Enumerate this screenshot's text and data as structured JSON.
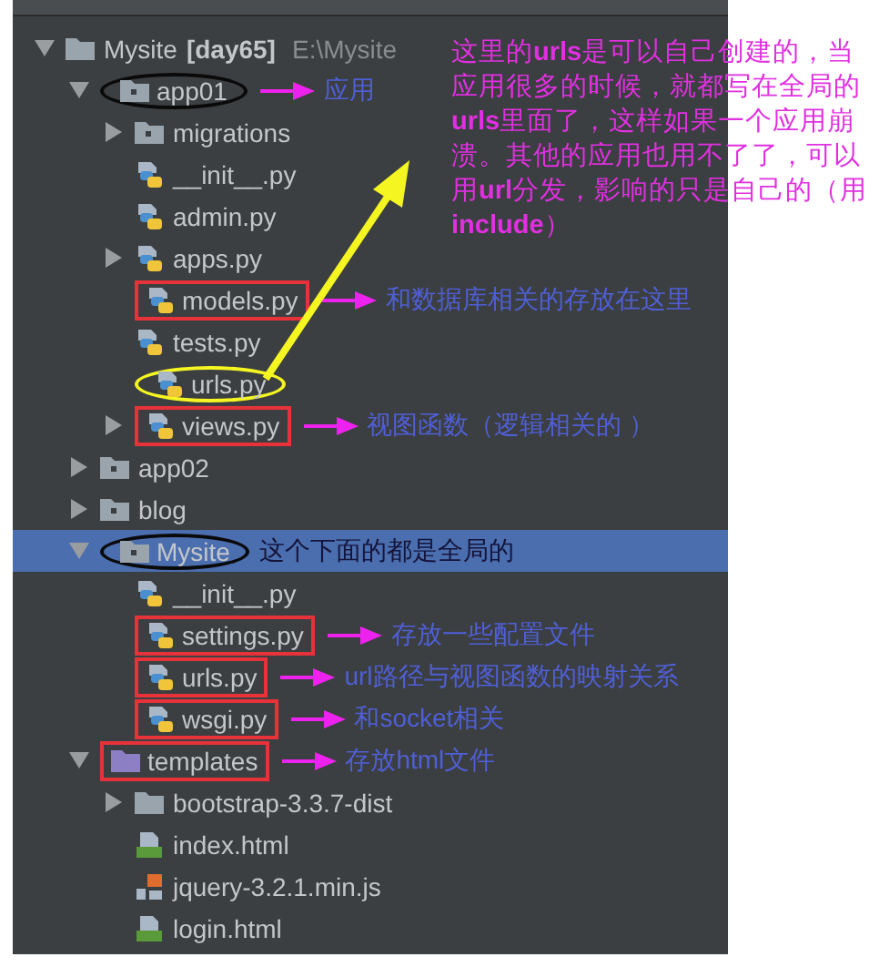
{
  "panel": {
    "tree": [
      {
        "label": "Mysite",
        "suffix": "[day65]",
        "path": "E:\\Mysite",
        "kind": "project",
        "expanded": true,
        "selected": false,
        "children": [
          {
            "label": "app01",
            "kind": "package",
            "expanded": true,
            "selected": false,
            "highlight": {
              "kind": "ellipse",
              "color": "#0a0a0a"
            },
            "note": {
              "text": "应用",
              "arrow": true,
              "color": "#4f5fd6"
            },
            "children": [
              {
                "label": "migrations",
                "kind": "package",
                "expanded": false,
                "selected": false
              },
              {
                "label": "__init__.py",
                "kind": "python",
                "selected": false
              },
              {
                "label": "admin.py",
                "kind": "python",
                "selected": false
              },
              {
                "label": "apps.py",
                "kind": "python",
                "expanded": false,
                "selected": false
              },
              {
                "label": "models.py",
                "kind": "python",
                "selected": false,
                "highlight": {
                  "kind": "box",
                  "color": "#e8323a"
                },
                "note": {
                  "text": "和数据库相关的存放在这里",
                  "arrow": true,
                  "color": "#4f5fd6"
                }
              },
              {
                "label": "tests.py",
                "kind": "python",
                "selected": false
              },
              {
                "label": "urls.py",
                "kind": "python",
                "selected": false,
                "highlight": {
                  "kind": "ellipse",
                  "color": "#f5f522"
                }
              },
              {
                "label": "views.py",
                "kind": "python",
                "expanded": false,
                "selected": false,
                "highlight": {
                  "kind": "box",
                  "color": "#e8323a"
                },
                "note": {
                  "text": "视图函数（逻辑相关的 ）",
                  "arrow": true,
                  "color": "#4f5fd6"
                }
              }
            ]
          },
          {
            "label": "app02",
            "kind": "package",
            "expanded": false,
            "selected": false
          },
          {
            "label": "blog",
            "kind": "package",
            "expanded": false,
            "selected": false
          },
          {
            "label": "Mysite",
            "kind": "package",
            "expanded": true,
            "selected": true,
            "highlight": {
              "kind": "ellipse",
              "color": "#0a0a0a"
            },
            "note": {
              "text": "这个下面的都是全局的",
              "arrow": false,
              "color": "#14143a"
            },
            "children": [
              {
                "label": "__init__.py",
                "kind": "python",
                "selected": false
              },
              {
                "label": "settings.py",
                "kind": "python",
                "selected": false,
                "highlight": {
                  "kind": "box",
                  "color": "#e8323a"
                },
                "note": {
                  "text": "存放一些配置文件",
                  "arrow": true,
                  "color": "#4f5fd6"
                }
              },
              {
                "label": "urls.py",
                "kind": "python",
                "selected": false,
                "highlight": {
                  "kind": "box",
                  "color": "#e8323a"
                },
                "note": {
                  "text": "url路径与视图函数的映射关系",
                  "arrow": true,
                  "color": "#4f5fd6"
                }
              },
              {
                "label": "wsgi.py",
                "kind": "python",
                "selected": false,
                "highlight": {
                  "kind": "box",
                  "color": "#e8323a"
                },
                "note": {
                  "text": "和socket相关",
                  "arrow": true,
                  "color": "#4f5fd6"
                }
              }
            ]
          },
          {
            "label": "templates",
            "kind": "templates",
            "expanded": true,
            "selected": false,
            "highlight": {
              "kind": "box",
              "color": "#e8323a"
            },
            "note": {
              "text": "存放html文件",
              "arrow": true,
              "color": "#4f5fd6"
            },
            "children": [
              {
                "label": "bootstrap-3.3.7-dist",
                "kind": "folder",
                "expanded": false,
                "selected": false
              },
              {
                "label": "index.html",
                "kind": "html",
                "selected": false
              },
              {
                "label": "jquery-3.2.1.min.js",
                "kind": "js",
                "selected": false
              },
              {
                "label": "login.html",
                "kind": "html",
                "selected": false
              }
            ]
          }
        ]
      }
    ]
  },
  "callout": {
    "text": "这里的**urls**是可以自己创建的，当应用很多的时候，就都写在全局的**urls**里面了，这样如果一个应用崩溃。其他的应用也用不了了，可以用**url**分发，影响的只是自己的（用**include**）"
  }
}
